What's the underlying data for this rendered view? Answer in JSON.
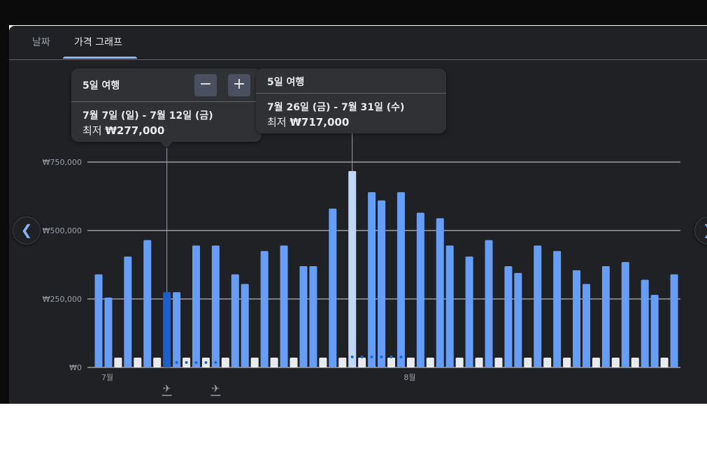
{
  "tabs": [
    {
      "label": "날짜",
      "active": false
    },
    {
      "label": "가격 그래프",
      "active": true
    }
  ],
  "tooltip_left": {
    "header": "5일 여행",
    "minus_label": "−",
    "plus_label": "+",
    "dates": "7월 7일 (일) - 7월 12일 (금)",
    "price_prefix": "최저",
    "price": "₩277,000"
  },
  "tooltip_right": {
    "header": "5일 여행",
    "dates": "7월 26일 (금) - 7월 31일 (수)",
    "price_prefix": "최저",
    "price": "₩717,000"
  },
  "nav": {
    "prev_icon": "chevron-left-icon",
    "next_icon": "chevron-right-icon"
  },
  "colors": {
    "panel": "#202124",
    "bar": "#669df6",
    "selected_bar": "#1a5fd0",
    "hover_bar": "#c2d7f7",
    "empty_bar": "#e8eaed",
    "grid": "#dadce0",
    "tick_label": "#9aa0a6",
    "dot": "#1967d2"
  },
  "markers": {
    "depart_icon": "airplane-departure-icon",
    "return_icon": "airplane-arrival-icon"
  },
  "chart_data": {
    "type": "bar",
    "ylim": [
      0,
      750000
    ],
    "y_ticks": [
      0,
      250000,
      500000,
      750000
    ],
    "y_tick_labels": [
      "₩0",
      "₩250,000",
      "₩500,000",
      "₩750,000"
    ],
    "x_labels": [
      {
        "index": 1,
        "label": "7월"
      },
      {
        "index": 32,
        "label": "8월"
      }
    ],
    "values": [
      340000,
      255000,
      null,
      405000,
      null,
      465000,
      null,
      275000,
      275000,
      null,
      445000,
      null,
      445000,
      null,
      340000,
      305000,
      null,
      425000,
      null,
      445000,
      null,
      370000,
      370000,
      null,
      580000,
      null,
      717000,
      null,
      640000,
      610000,
      null,
      640000,
      null,
      565000,
      null,
      545000,
      445000,
      null,
      405000,
      null,
      465000,
      null,
      370000,
      345000,
      null,
      445000,
      null,
      425000,
      null,
      355000,
      305000,
      null,
      370000,
      null,
      385000,
      null,
      320000,
      265000,
      null,
      340000
    ],
    "selected_index": 7,
    "hover_index": 26,
    "depart_index": 7,
    "return_index": 12
  }
}
